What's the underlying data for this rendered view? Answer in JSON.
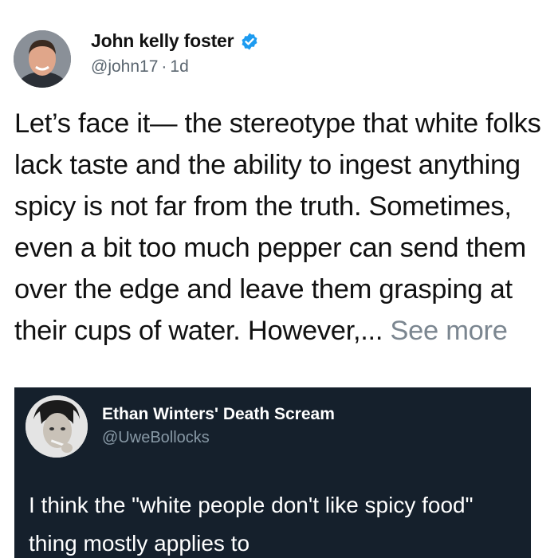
{
  "author": {
    "display_name": "John kelly foster",
    "handle": "@john17",
    "time_ago": "1d",
    "verified": true
  },
  "tweet": {
    "text": "Let’s face it— the stereotype that white folks lack taste and the ability to ingest anything spicy is not far from the truth. Sometimes, even a bit too much pepper can send them over the edge and leave them grasping at their cups of water. However,...",
    "see_more": "See more"
  },
  "quoted_tweet": {
    "display_name": "Ethan Winters' Death Scream",
    "handle": "@UweBollocks",
    "text": "I think the \"white people don't like spicy food\" thing mostly applies to"
  },
  "colors": {
    "verified_blue": "#1d9bf0",
    "card_background": "#15202c",
    "muted_text": "#5b6670"
  },
  "icons": {
    "verified": "verified-badge-icon"
  }
}
